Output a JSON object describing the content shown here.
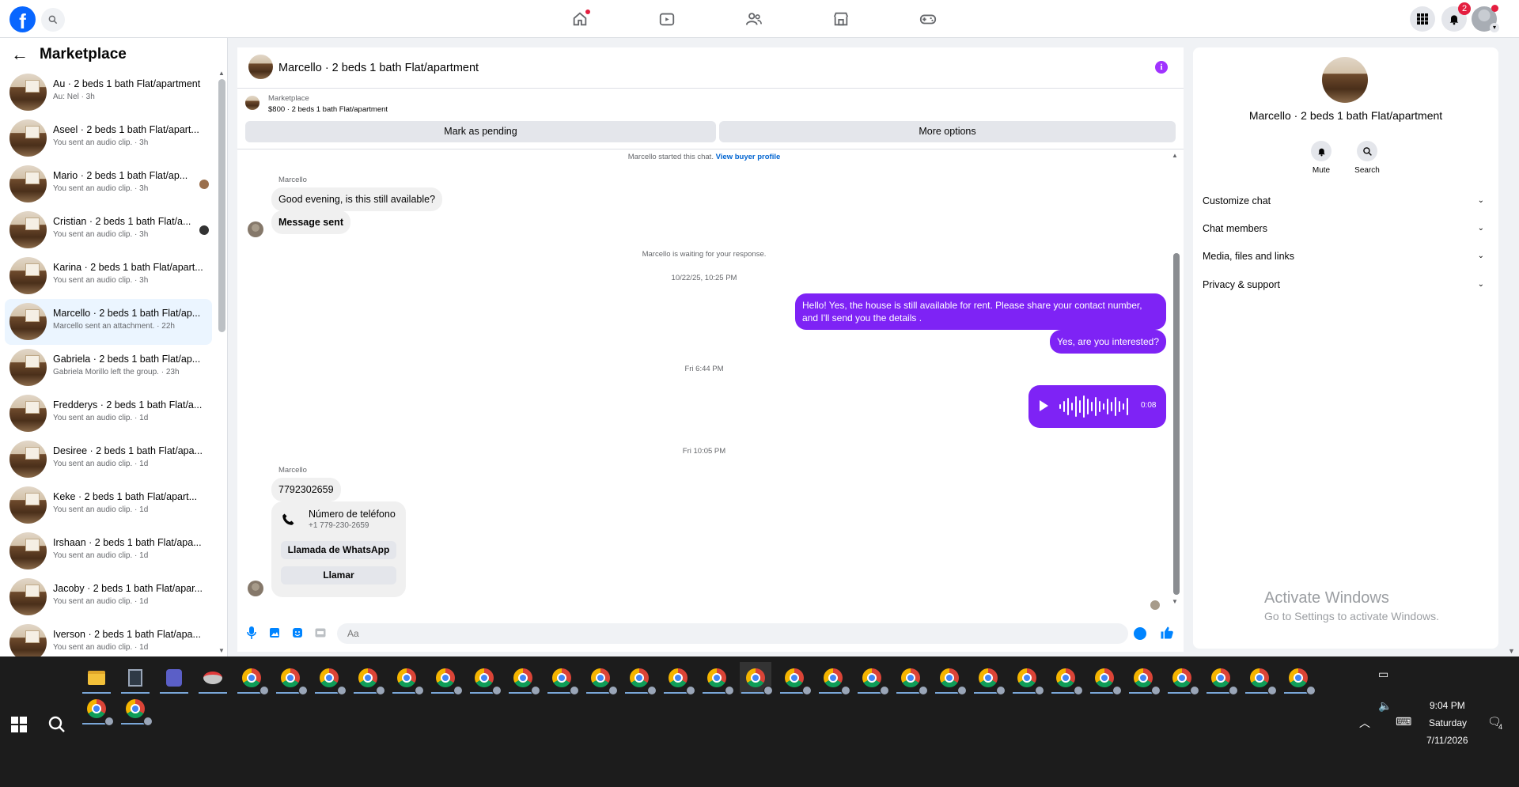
{
  "sidebar": {
    "title": "Marketplace",
    "conversations": [
      {
        "name": "Au · 2 beds 1 bath Flat/apartment",
        "preview": "Au: Nel · 3h"
      },
      {
        "name": "Aseel · 2 beds 1 bath Flat/apart...",
        "preview": "You sent an audio clip. · 3h"
      },
      {
        "name": "Mario · 2 beds 1 bath Flat/ap...",
        "preview": "You sent an audio clip. · 3h"
      },
      {
        "name": "Cristian · 2 beds 1 bath Flat/a...",
        "preview": "You sent an audio clip. · 3h"
      },
      {
        "name": "Karina · 2 beds 1 bath Flat/apart...",
        "preview": "You sent an audio clip. · 3h"
      },
      {
        "name": "Marcello · 2 beds 1 bath Flat/ap...",
        "preview": "Marcello sent an attachment. · 22h"
      },
      {
        "name": "Gabriela · 2 beds 1 bath Flat/ap...",
        "preview": "Gabriela Morillo left the group. · 23h"
      },
      {
        "name": "Fredderys · 2 beds 1 bath Flat/a...",
        "preview": "You sent an audio clip. · 1d"
      },
      {
        "name": "Desiree · 2 beds 1 bath Flat/apa...",
        "preview": "You sent an audio clip. · 1d"
      },
      {
        "name": "Keke · 2 beds 1 bath Flat/apart...",
        "preview": "You sent an audio clip. · 1d"
      },
      {
        "name": "Irshaan · 2 beds 1 bath Flat/apa...",
        "preview": "You sent an audio clip. · 1d"
      },
      {
        "name": "Jacoby · 2 beds 1 bath Flat/apar...",
        "preview": "You sent an audio clip. · 1d"
      },
      {
        "name": "Iverson · 2 beds 1 bath Flat/apa...",
        "preview": "You sent an audio clip. · 1d"
      }
    ]
  },
  "topbar": {
    "notification_count": "2"
  },
  "chat": {
    "title": "Marcello · 2 beds 1 bath Flat/apartment",
    "listing_label": "Marketplace",
    "listing_price": "$800 · 2 beds 1 bath Flat/apartment",
    "mark_pending": "Mark as pending",
    "more_options": "More options",
    "started_text": "Marcello started this chat.",
    "buyer_profile_link": "View buyer profile",
    "sender_name": "Marcello",
    "msg1": "Good evening, is this still available?",
    "msg2": "Message sent",
    "waiting_text": "Marcello is waiting for your response.",
    "time1": "10/22/25, 10:25 PM",
    "out1": "Hello! Yes, the house is still available for rent. Please share your contact number, and I'll send you the details .",
    "out2": "Yes, are you interested?",
    "time2": "Fri 6:44 PM",
    "audio_duration": "0:08",
    "time3": "Fri 10:05 PM",
    "sender_name2": "Marcello",
    "phone_msg": "7792302659",
    "card_title": "Número de teléfono",
    "card_number": "+1 779-230-2659",
    "card_btn_whatsapp": "Llamada de WhatsApp",
    "card_btn_call": "Llamar",
    "composer_placeholder": "Aa"
  },
  "right_panel": {
    "title": "Marcello · 2 beds 1 bath Flat/apartment",
    "mute_label": "Mute",
    "search_label": "Search",
    "sections": [
      "Customize chat",
      "Chat members",
      "Media, files and links",
      "Privacy & support"
    ]
  },
  "watermark": {
    "title": "Activate Windows",
    "subtitle": "Go to Settings to activate Windows."
  },
  "taskbar": {
    "time": "9:04 PM",
    "day": "Saturday",
    "date": "7/11/2026",
    "action_center_count": "4"
  }
}
